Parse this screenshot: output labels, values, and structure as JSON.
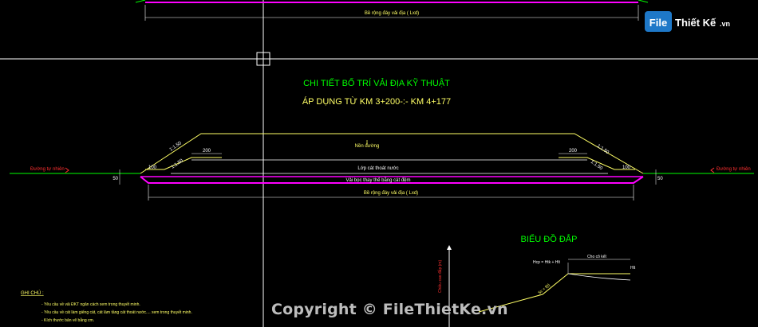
{
  "title_line1": "CHI TIẾT BỐ TRÍ VẢI ĐỊA KỸ THUẬT",
  "title_line2": "ÁP DỤNG TỪ KM 3+200-:- KM 4+177",
  "chart_title": "BIỂU ĐỒ ĐẮP",
  "labels": {
    "width_top": "Bề rộng đáy vải địa ( Lxd)",
    "width_bottom": "Bề rộng đáy vải địa ( Lxd)",
    "road_surface": "Nền đường",
    "drain_layer": "Lớp cát thoát nước",
    "geotextile": "Vải bọc thay thế bằng cát đệm",
    "natural_ground_left": "Đường tự nhiên",
    "natural_ground_right": "Đường tự nhiên",
    "slope_left_top": "1:1.50",
    "slope_left_bottom": "1:1.50",
    "slope_right_top": "1:1.50",
    "slope_right_bottom": "1:1.50",
    "dim_200_left": "200",
    "dim_200_right": "200",
    "dim_100_left": "100",
    "dim_100_right": "100",
    "dim_50_left": "50",
    "dim_50_right": "50",
    "chart_height_axis": "Chiều cao đắp (m)",
    "chart_fill_label": "Cho cô kết",
    "chart_h_label": "Hcp = Htk + Hlt",
    "chart_slope": "Sc = f(t)",
    "chart_hlt": "Hlt"
  },
  "notes": {
    "heading": "GHI CHÚ :",
    "items": [
      "- Yêu cầu về vải ĐKT ngăn cách xem trong thuyết minh.",
      "- Yêu cầu về cát làm giếng cát, cát làm tầng cát thoát nước.... xem trong thuyết minh.",
      "- Kích thước bản vẽ bằng cm."
    ]
  },
  "watermark": {
    "logo_text_1": "File",
    "logo_text_2": "Thiết Kế",
    "logo_text_3": ".vn",
    "copyright": "Copyright © FileThietKe.vn"
  },
  "colors": {
    "magenta": "#ff00ff",
    "yellow": "#ffff66",
    "green": "#00ff00",
    "white": "#ffffff",
    "cyan": "#00c0ff",
    "red": "#ff3030"
  }
}
